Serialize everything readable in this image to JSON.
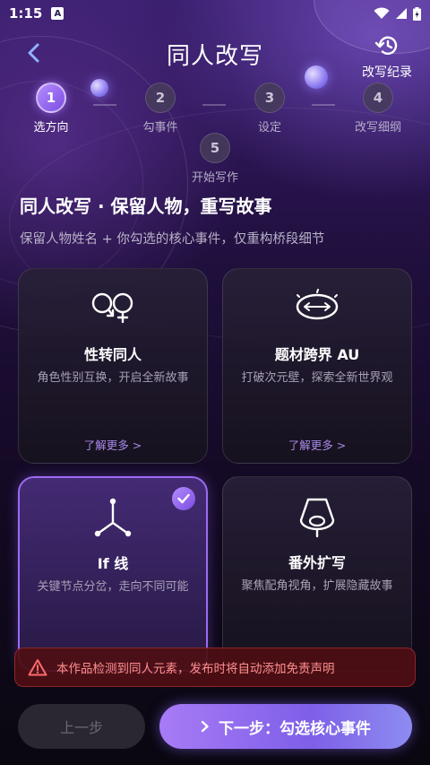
{
  "status_bar": {
    "time": "1:15",
    "notification_badge": "A"
  },
  "header": {
    "title": "同人改写",
    "history_label": "改写纪录"
  },
  "steps": [
    {
      "number": "1",
      "label": "选方向",
      "active": true
    },
    {
      "number": "2",
      "label": "勾事件",
      "active": false
    },
    {
      "number": "3",
      "label": "设定",
      "active": false
    },
    {
      "number": "4",
      "label": "改写细纲",
      "active": false
    },
    {
      "number": "5",
      "label": "开始写作",
      "active": false
    }
  ],
  "intro": {
    "headline": "同人改写 · 保留人物，重写故事",
    "subline": "保留人物姓名 + 你勾选的核心事件，仅重构桥段细节"
  },
  "cards": [
    {
      "title": "性转同人",
      "desc": "角色性别互换，开启全新故事",
      "more": "了解更多 >",
      "icon": "gender-swap-icon",
      "selected": false
    },
    {
      "title": "题材跨界 AU",
      "desc": "打破次元壁，探索全新世界观",
      "more": "了解更多 >",
      "icon": "portal-icon",
      "selected": false
    },
    {
      "title": "If 线",
      "desc": "关键节点分岔，走向不同可能",
      "more": "",
      "icon": "branch-icon",
      "selected": true
    },
    {
      "title": "番外扩写",
      "desc": "聚焦配角视角，扩展隐藏故事",
      "more": "",
      "icon": "spotlight-icon",
      "selected": false
    }
  ],
  "warning": {
    "text": "本作品检测到同人元素，发布时将自动添加免责声明"
  },
  "footer": {
    "prev_label": "上一步",
    "next_label": "下一步：勾选核心事件"
  },
  "colors": {
    "accent": "#9a6cf0",
    "warning_text": "#ff8f8f",
    "background": "#1f0f3c"
  }
}
